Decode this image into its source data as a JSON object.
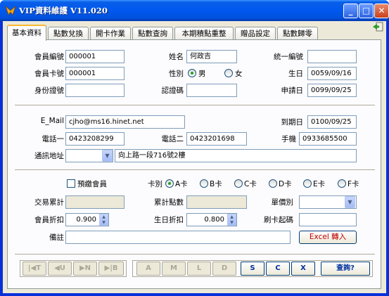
{
  "window": {
    "title": "VIP資料維護 V11.020"
  },
  "tabs": [
    "基本資料",
    "點數兌換",
    "開卡作業",
    "點數查詢",
    "本期積點重整",
    "贈品設定",
    "點數歸零"
  ],
  "labels": {
    "member_no": "會員編號",
    "name": "姓名",
    "tax_id": "統一編號",
    "card_no": "會員卡號",
    "gender": "性別",
    "birthday": "生日",
    "id_no": "身份證號",
    "verify_code": "認證碼",
    "apply_date": "申請日",
    "email": "E_Mail",
    "expire_date": "到期日",
    "phone1": "電話一",
    "phone2": "電話二",
    "mobile": "手機",
    "address": "通訊地址",
    "prepaid": "預繳會員",
    "card_type": "卡別",
    "trade_total": "交易累計",
    "points_total": "累計點數",
    "price_type": "單價別",
    "discount": "會員折扣",
    "birthday_discount": "生日折扣",
    "card_start": "刷卡起碼",
    "remark": "備註"
  },
  "values": {
    "member_no": "000001",
    "name": "何政吉",
    "tax_id": "",
    "card_no": "000001",
    "birthday": "0059/09/16",
    "id_no": "",
    "verify_code": "",
    "apply_date": "0099/09/25",
    "email": "cjho@ms16.hinet.net",
    "expire_date": "0100/09/25",
    "phone1": "0423208299",
    "phone2": "0423201698",
    "mobile": "0933685500",
    "address_zip": "",
    "address": "向上路一段716號2樓",
    "trade_total": "",
    "points_total": "",
    "price_type": "",
    "discount": "0.900",
    "birthday_discount": "0.800",
    "card_start": "",
    "remark": ""
  },
  "gender_options": [
    "男",
    "女"
  ],
  "gender_selected": "男",
  "card_types": [
    "A卡",
    "B卡",
    "C卡",
    "D卡",
    "E卡",
    "F卡"
  ],
  "card_type_selected": "A卡",
  "buttons": {
    "excel_import": "Excel 轉入"
  },
  "nav_buttons": [
    "|◀T",
    "◀U",
    "▶N",
    "▶|B"
  ],
  "edit_buttons": [
    "A",
    "M",
    "L",
    "D",
    "S",
    "C",
    "X",
    "查詢?"
  ],
  "colors": {
    "title_bar": "#0058ee",
    "panel": "#fcfcfe",
    "excel_text": "#c00000"
  }
}
